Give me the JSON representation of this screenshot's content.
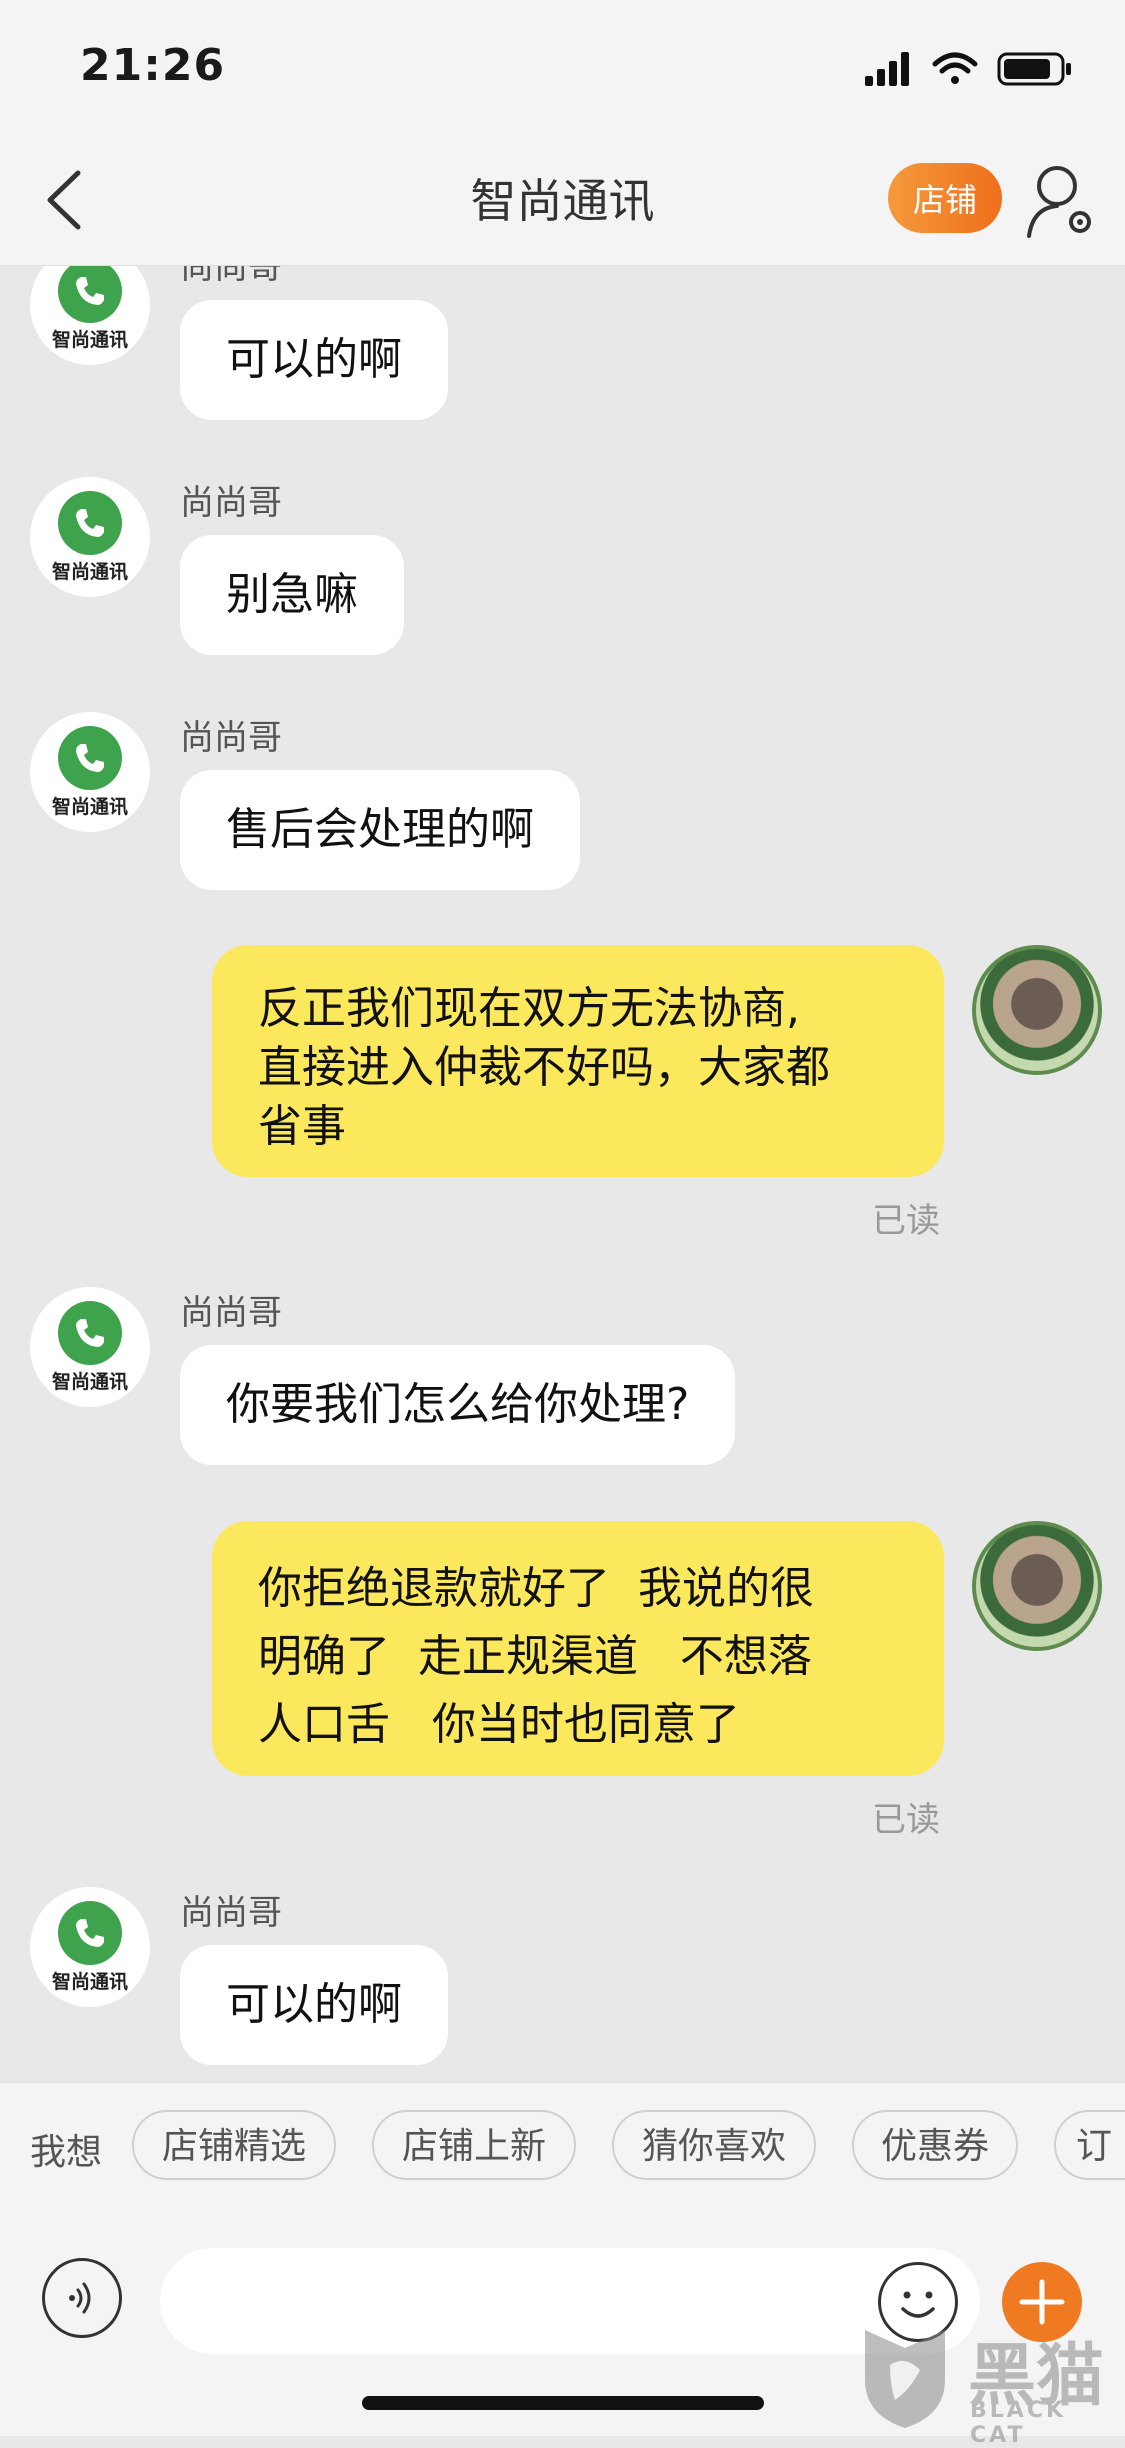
{
  "status": {
    "time": "21:26"
  },
  "nav": {
    "title": "智尚通讯",
    "shop_button": "店铺"
  },
  "shop_avatar": {
    "brand": "智尚通讯"
  },
  "messages": [
    {
      "from": "shop",
      "sender": "尚尚哥",
      "text": "可以的啊"
    },
    {
      "from": "shop",
      "sender": "尚尚哥",
      "text": "别急嘛"
    },
    {
      "from": "shop",
      "sender": "尚尚哥",
      "text": "售后会处理的啊"
    },
    {
      "from": "me",
      "lines": [
        "反正我们现在双方无法协商,",
        "直接进入仲裁不好吗，大家都",
        "省事"
      ],
      "read": "已读"
    },
    {
      "from": "shop",
      "sender": "尚尚哥",
      "text": "你要我们怎么给你处理?"
    },
    {
      "from": "me",
      "lines": [
        "你拒绝退款就好了  我说的很",
        "明确了  走正规渠道   不想落",
        "人口舌   你当时也同意了"
      ],
      "read": "已读"
    },
    {
      "from": "shop",
      "sender": "尚尚哥",
      "text": "可以的啊"
    }
  ],
  "quick": {
    "label": "我想",
    "chips": [
      "店铺精选",
      "店铺上新",
      "猜你喜欢",
      "优惠券",
      "订单"
    ]
  },
  "input": {
    "placeholder": ""
  },
  "watermark": {
    "cn": "黑猫",
    "en": "BLACK CAT"
  },
  "colors": {
    "accent": "#ef6f1c",
    "my_bubble": "#fce85c",
    "shop_bubble": "#ffffff"
  }
}
